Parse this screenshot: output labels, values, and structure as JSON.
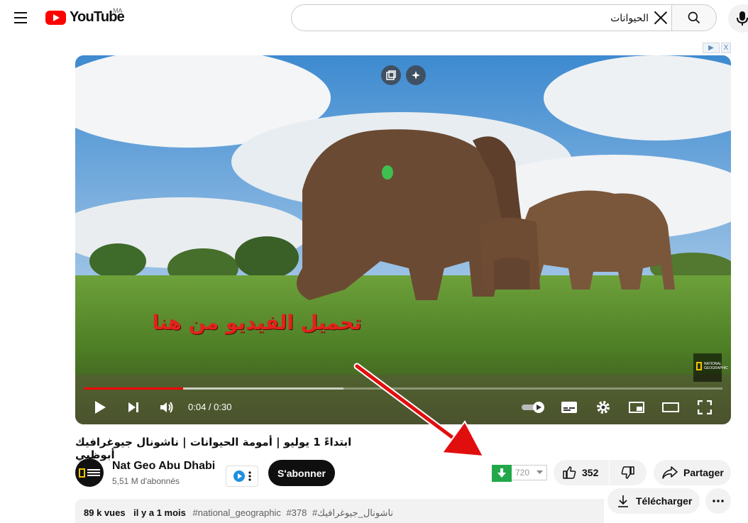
{
  "header": {
    "logo_text": "YouTube",
    "country_code": "MA",
    "search_value": "الحيوانات",
    "menu_icon": "hamburger-menu-icon",
    "search_icon": "search-icon",
    "mic_icon": "microphone-icon"
  },
  "ad_badge": {
    "play": "▶",
    "close": "X"
  },
  "player": {
    "overlay_text": "تحميل الفيديو من هنا",
    "time": "0:04 / 0:30",
    "progress_played": 0.155,
    "progress_buffered": 0.407,
    "watermark_label": "NATIONAL GEOGRAPHIC"
  },
  "video": {
    "title": "ابتداءً 1 يوليو | أمومة الحيوانات | ناشونال جيوغرافيك أبوظبي"
  },
  "channel": {
    "name": "Nat Geo Abu Dhabi",
    "subscribers": "5,51 M d'abonnés",
    "subscribe_label": "S'abonner"
  },
  "downloader": {
    "quality": "720"
  },
  "actions": {
    "likes": "352",
    "share_label": "Partager",
    "download_label": "Télécharger"
  },
  "description": {
    "views": "89 k vues",
    "date": "il y a 1 mois",
    "tags": [
      "#national_geographic",
      "#378",
      "#ناشونال_جيوغرافيك"
    ]
  },
  "colors": {
    "brand_red": "#ff0000",
    "download_green": "#22a84a",
    "overlay_red": "#e3221c"
  }
}
